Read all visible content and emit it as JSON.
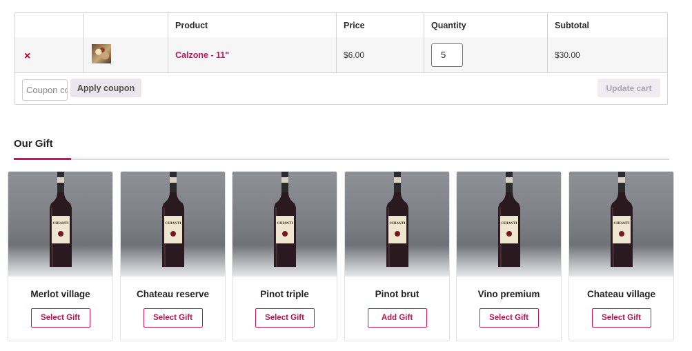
{
  "cart": {
    "headers": [
      "",
      "",
      "Product",
      "Price",
      "Quantity",
      "Subtotal"
    ],
    "items": [
      {
        "remove_icon": "close-icon",
        "remove_symbol": "×",
        "thumbnail": "pizza-thumbnail-image",
        "product": "Calzone - 11\"",
        "price": "$6.00",
        "quantity": "5",
        "subtotal": "$30.00"
      }
    ],
    "coupon_placeholder": "Coupon code",
    "apply_coupon_label": "Apply coupon",
    "update_cart_label": "Update cart"
  },
  "gift": {
    "title": "Our Gift",
    "items": [
      {
        "name": "Merlot village",
        "button": "Select Gift"
      },
      {
        "name": "Chateau reserve",
        "button": "Select Gift"
      },
      {
        "name": "Pinot triple",
        "button": "Select Gift"
      },
      {
        "name": "Pinot brut",
        "button": "Add Gift"
      },
      {
        "name": "Vino premium",
        "button": "Select Gift"
      },
      {
        "name": "Chateau village",
        "button": "Select Gift"
      }
    ],
    "bottle_label": "CHIANTI"
  },
  "colors": {
    "accent": "#c2185b",
    "remove": "#b7021d",
    "row_background": "#f7f6f7"
  }
}
